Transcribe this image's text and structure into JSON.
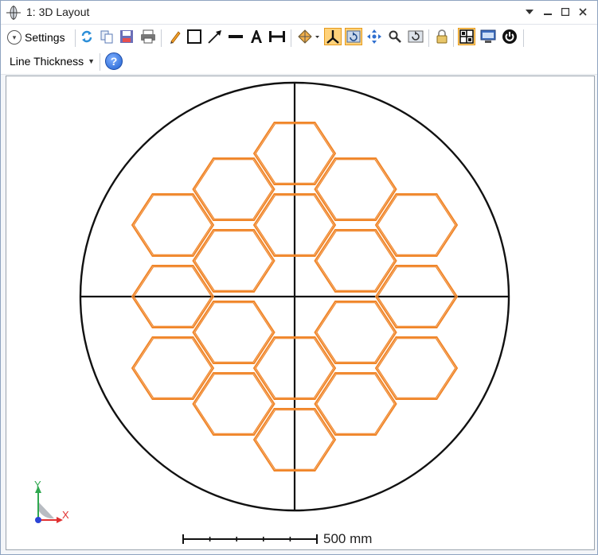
{
  "window": {
    "title": "1: 3D Layout",
    "controls": [
      "dropdown-arrow",
      "minimize",
      "maximize",
      "close"
    ]
  },
  "toolbar": {
    "settings_label": "Settings",
    "line_thickness_label": "Line Thickness",
    "tools": [
      "refresh-icon",
      "copy-icon",
      "save-icon",
      "print-icon",
      "pencil-icon",
      "rectangle-icon",
      "arrow-line-icon",
      "line-icon",
      "text-icon",
      "dimension-icon",
      "rotate-view-icon",
      "axes-icon",
      "rotate-icon",
      "pan-icon",
      "zoom-icon",
      "reset-view-icon",
      "lock-icon",
      "layout-icon",
      "window-icon",
      "power-icon"
    ],
    "active_tools": [
      "axes-icon",
      "rotate-icon",
      "layout-icon"
    ]
  },
  "canvas": {
    "scale_bar_label": "500 mm",
    "axis_x_label": "X",
    "axis_y_label": "Y",
    "colors": {
      "segments": "#f0862a",
      "aperture": "#111111",
      "axes_x": "#e03030",
      "axes_y": "#2fa84f",
      "axes_z": "#2b44d6"
    },
    "segment_count": 18
  }
}
